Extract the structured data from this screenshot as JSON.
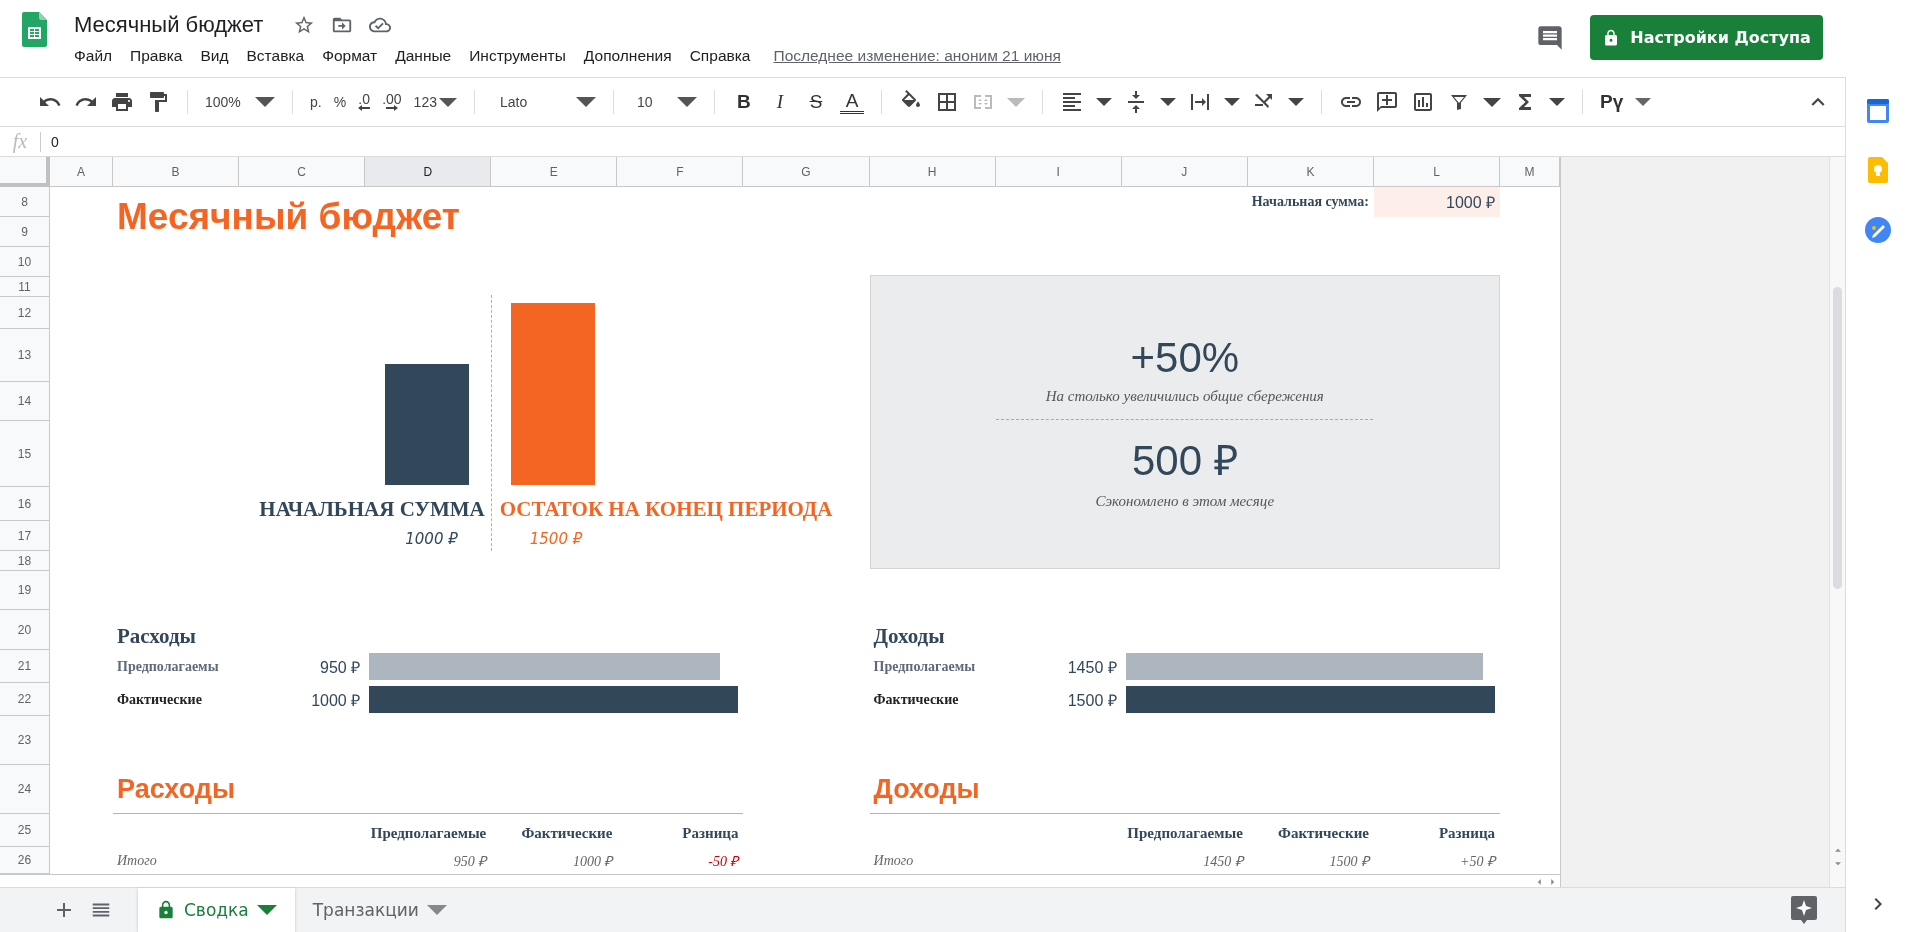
{
  "document": {
    "title": "Месячный бюджет",
    "last_edit": "Последнее изменение: аноним 21 июня"
  },
  "menu": [
    "Файл",
    "Правка",
    "Вид",
    "Вставка",
    "Формат",
    "Данные",
    "Инструменты",
    "Дополнения",
    "Справка"
  ],
  "share_button": {
    "label": "Настройки Доступа"
  },
  "toolbar": {
    "zoom": "100%",
    "currency": "р.",
    "percent": "%",
    "decrease_decimals": ".0",
    "increase_decimals": ".00",
    "number_format": "123",
    "font": "Lato",
    "font_size": "10",
    "bold": "B",
    "italic": "I",
    "strikethrough": "S",
    "text_color": "A",
    "input_tools": "Рү"
  },
  "formula_bar": {
    "label": "fx",
    "value": "0"
  },
  "columns": [
    {
      "label": "A",
      "selected": false
    },
    {
      "label": "B",
      "selected": false
    },
    {
      "label": "C",
      "selected": false
    },
    {
      "label": "D",
      "selected": true
    },
    {
      "label": "E",
      "selected": false
    },
    {
      "label": "F",
      "selected": false
    },
    {
      "label": "G",
      "selected": false
    },
    {
      "label": "H",
      "selected": false
    },
    {
      "label": "I",
      "selected": false
    },
    {
      "label": "J",
      "selected": false
    },
    {
      "label": "K",
      "selected": false
    },
    {
      "label": "L",
      "selected": false
    },
    {
      "label": "M",
      "selected": false
    }
  ],
  "rows": [
    "8",
    "9",
    "10",
    "11",
    "12",
    "13",
    "14",
    "15",
    "16",
    "17",
    "18",
    "19",
    "20",
    "21",
    "22",
    "23",
    "24",
    "25",
    "26"
  ],
  "sheet": {
    "title": "Месячный бюджет",
    "starting_balance": {
      "label": "Начальная сумма:",
      "value": "1000 ₽"
    },
    "summary_bars": [
      {
        "label": "НАЧАЛЬНАЯ СУММА",
        "value": "1000 ₽",
        "level": 0.667,
        "color": "#33475b"
      },
      {
        "label": "ОСТАТОК НА КОНЕЦ ПЕРИОДА",
        "value": "1500 ₽",
        "level": 1,
        "color": "#f46524"
      }
    ],
    "savings": {
      "percent": "+50%",
      "percent_caption": "На столько увеличились общие сбережения",
      "amount": "500 ₽",
      "amount_caption": "Сэкономлено в этом месяце"
    },
    "meters": [
      {
        "title": "Расходы",
        "items": [
          {
            "kind": "planned",
            "label": "Предполагаемы",
            "value": "950 ₽",
            "level": 0.95
          },
          {
            "kind": "actual",
            "label": "Фактические",
            "value": "1000 ₽",
            "level": 1
          }
        ]
      },
      {
        "title": "Доходы",
        "items": [
          {
            "kind": "planned",
            "label": "Предполагаемы",
            "value": "1450 ₽",
            "level": 0.967
          },
          {
            "kind": "actual",
            "label": "Фактические",
            "value": "1500 ₽",
            "level": 1
          }
        ]
      }
    ],
    "tables": [
      {
        "title": "Расходы",
        "columns": [
          "Предполагаемые",
          "Фактические",
          "Разница"
        ],
        "rows": [
          {
            "label": "Итого",
            "cells": [
              "950 ₽",
              "1000 ₽",
              "-50 ₽"
            ],
            "negative": true
          }
        ]
      },
      {
        "title": "Доходы",
        "columns": [
          "Предполагаемые",
          "Фактические",
          "Разница"
        ],
        "rows": [
          {
            "label": "Итого",
            "cells": [
              "1450 ₽",
              "1500 ₽",
              "+50 ₽"
            ],
            "negative": false
          }
        ]
      }
    ]
  },
  "sheet_tabs": [
    {
      "label": "Сводка",
      "selected": true,
      "locked": true
    },
    {
      "label": "Транзакции",
      "selected": false,
      "locked": false
    }
  ]
}
